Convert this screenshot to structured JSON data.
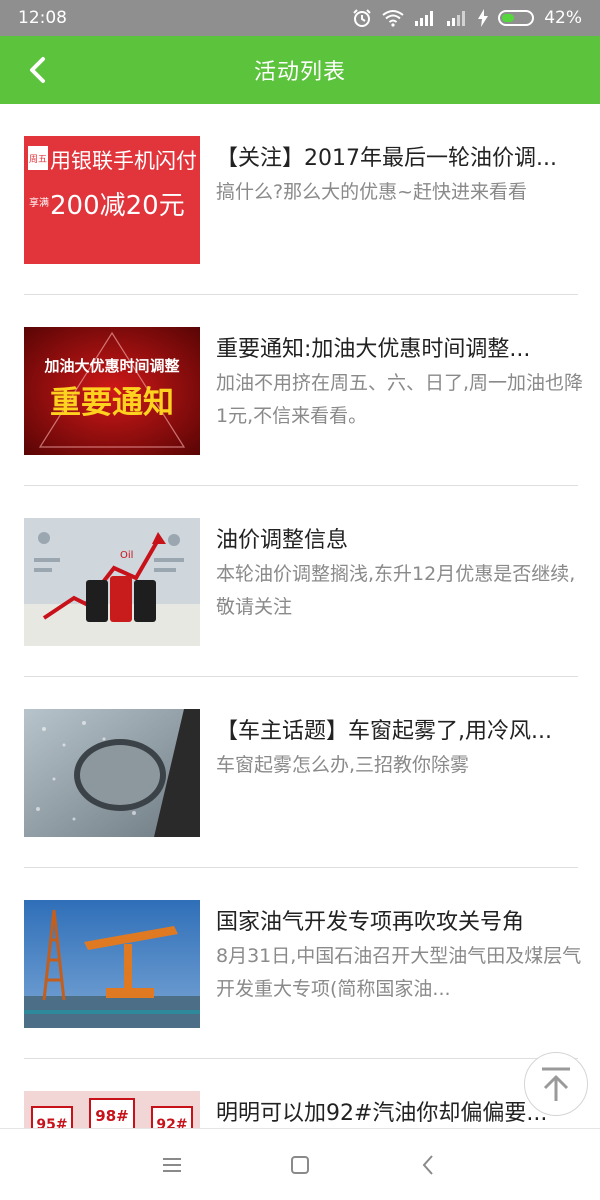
{
  "status_bar": {
    "time": "12:08",
    "battery": "42%",
    "battery_level": 0.42
  },
  "app_bar": {
    "title": "活动列表"
  },
  "colors": {
    "accent": "#5cc33d",
    "status_bar": "#8f8f8f",
    "title_text": "#222222",
    "desc_text": "#8a8a8a"
  },
  "items": [
    {
      "title": "【关注】2017年最后一轮油价调...",
      "desc": "搞什么?那么大的优惠~赶快进来看看",
      "thumb": {
        "line1": "用银联手机闪付",
        "badge": "周五",
        "prefix": "享满",
        "line2": "200减20元"
      }
    },
    {
      "title": "重要通知:加油大优惠时间调整...",
      "desc": " 加油不用挤在周五、六、日了,周一加油也降1元,不信来看看。",
      "thumb": {
        "line1": "加油大优惠时间调整",
        "line2": "重要通知"
      }
    },
    {
      "title": "油价调整信息",
      "desc": " 本轮油价调整搁浅,东升12月优惠是否继续,敬请关注",
      "thumb": {
        "label": "Oil"
      }
    },
    {
      "title": "【车主话题】车窗起雾了,用冷风...",
      "desc": "车窗起雾怎么办,三招教你除雾",
      "thumb": {}
    },
    {
      "title": "国家油气开发专项再吹攻关号角",
      "desc": " 8月31日,中国石油召开大型油气田及煤层气开发重大专项(简称国家油...",
      "thumb": {}
    },
    {
      "title": "明明可以加92#汽油你却偏偏要...",
      "desc": "",
      "thumb": {
        "labels": [
          "95#",
          "98#",
          "92#"
        ]
      }
    }
  ]
}
